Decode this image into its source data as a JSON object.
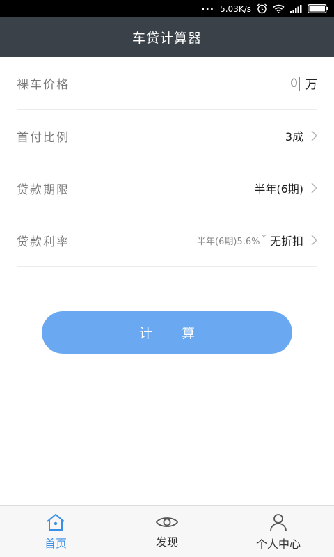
{
  "status_bar": {
    "network_speed": "5.03K/s",
    "dots": "..."
  },
  "title": "车贷计算器",
  "form": {
    "price": {
      "label": "裸车价格",
      "value": "0",
      "unit": "万"
    },
    "down_payment": {
      "label": "首付比例",
      "value": "3成"
    },
    "loan_term": {
      "label": "贷款期限",
      "value": "半年(6期)"
    },
    "interest_rate": {
      "label": "贷款利率",
      "sub": "半年(6期)5.6%",
      "star": "*",
      "value": "无折扣"
    }
  },
  "calculate_button": "计 算",
  "bottom_nav": {
    "items": [
      {
        "label": "首页",
        "icon": "home-icon",
        "active": true
      },
      {
        "label": "发现",
        "icon": "eye-icon",
        "active": false
      },
      {
        "label": "个人中心",
        "icon": "user-icon",
        "active": false
      }
    ]
  },
  "colors": {
    "title_bar": "#3a4149",
    "accent": "#3a8ee6",
    "button": "#6aa8f2"
  }
}
